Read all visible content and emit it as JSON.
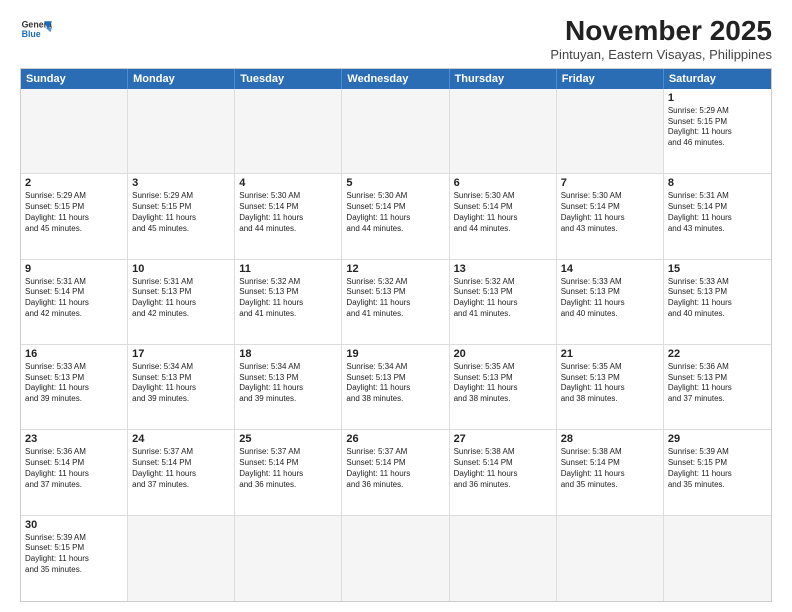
{
  "logo": {
    "line1": "General",
    "line2": "Blue"
  },
  "title": "November 2025",
  "subtitle": "Pintuyan, Eastern Visayas, Philippines",
  "header_days": [
    "Sunday",
    "Monday",
    "Tuesday",
    "Wednesday",
    "Thursday",
    "Friday",
    "Saturday"
  ],
  "weeks": [
    [
      {
        "day": "",
        "text": ""
      },
      {
        "day": "",
        "text": ""
      },
      {
        "day": "",
        "text": ""
      },
      {
        "day": "",
        "text": ""
      },
      {
        "day": "",
        "text": ""
      },
      {
        "day": "",
        "text": ""
      },
      {
        "day": "1",
        "text": "Sunrise: 5:29 AM\nSunset: 5:15 PM\nDaylight: 11 hours\nand 46 minutes."
      }
    ],
    [
      {
        "day": "2",
        "text": "Sunrise: 5:29 AM\nSunset: 5:15 PM\nDaylight: 11 hours\nand 45 minutes."
      },
      {
        "day": "3",
        "text": "Sunrise: 5:29 AM\nSunset: 5:15 PM\nDaylight: 11 hours\nand 45 minutes."
      },
      {
        "day": "4",
        "text": "Sunrise: 5:30 AM\nSunset: 5:14 PM\nDaylight: 11 hours\nand 44 minutes."
      },
      {
        "day": "5",
        "text": "Sunrise: 5:30 AM\nSunset: 5:14 PM\nDaylight: 11 hours\nand 44 minutes."
      },
      {
        "day": "6",
        "text": "Sunrise: 5:30 AM\nSunset: 5:14 PM\nDaylight: 11 hours\nand 44 minutes."
      },
      {
        "day": "7",
        "text": "Sunrise: 5:30 AM\nSunset: 5:14 PM\nDaylight: 11 hours\nand 43 minutes."
      },
      {
        "day": "8",
        "text": "Sunrise: 5:31 AM\nSunset: 5:14 PM\nDaylight: 11 hours\nand 43 minutes."
      }
    ],
    [
      {
        "day": "9",
        "text": "Sunrise: 5:31 AM\nSunset: 5:14 PM\nDaylight: 11 hours\nand 42 minutes."
      },
      {
        "day": "10",
        "text": "Sunrise: 5:31 AM\nSunset: 5:13 PM\nDaylight: 11 hours\nand 42 minutes."
      },
      {
        "day": "11",
        "text": "Sunrise: 5:32 AM\nSunset: 5:13 PM\nDaylight: 11 hours\nand 41 minutes."
      },
      {
        "day": "12",
        "text": "Sunrise: 5:32 AM\nSunset: 5:13 PM\nDaylight: 11 hours\nand 41 minutes."
      },
      {
        "day": "13",
        "text": "Sunrise: 5:32 AM\nSunset: 5:13 PM\nDaylight: 11 hours\nand 41 minutes."
      },
      {
        "day": "14",
        "text": "Sunrise: 5:33 AM\nSunset: 5:13 PM\nDaylight: 11 hours\nand 40 minutes."
      },
      {
        "day": "15",
        "text": "Sunrise: 5:33 AM\nSunset: 5:13 PM\nDaylight: 11 hours\nand 40 minutes."
      }
    ],
    [
      {
        "day": "16",
        "text": "Sunrise: 5:33 AM\nSunset: 5:13 PM\nDaylight: 11 hours\nand 39 minutes."
      },
      {
        "day": "17",
        "text": "Sunrise: 5:34 AM\nSunset: 5:13 PM\nDaylight: 11 hours\nand 39 minutes."
      },
      {
        "day": "18",
        "text": "Sunrise: 5:34 AM\nSunset: 5:13 PM\nDaylight: 11 hours\nand 39 minutes."
      },
      {
        "day": "19",
        "text": "Sunrise: 5:34 AM\nSunset: 5:13 PM\nDaylight: 11 hours\nand 38 minutes."
      },
      {
        "day": "20",
        "text": "Sunrise: 5:35 AM\nSunset: 5:13 PM\nDaylight: 11 hours\nand 38 minutes."
      },
      {
        "day": "21",
        "text": "Sunrise: 5:35 AM\nSunset: 5:13 PM\nDaylight: 11 hours\nand 38 minutes."
      },
      {
        "day": "22",
        "text": "Sunrise: 5:36 AM\nSunset: 5:13 PM\nDaylight: 11 hours\nand 37 minutes."
      }
    ],
    [
      {
        "day": "23",
        "text": "Sunrise: 5:36 AM\nSunset: 5:14 PM\nDaylight: 11 hours\nand 37 minutes."
      },
      {
        "day": "24",
        "text": "Sunrise: 5:37 AM\nSunset: 5:14 PM\nDaylight: 11 hours\nand 37 minutes."
      },
      {
        "day": "25",
        "text": "Sunrise: 5:37 AM\nSunset: 5:14 PM\nDaylight: 11 hours\nand 36 minutes."
      },
      {
        "day": "26",
        "text": "Sunrise: 5:37 AM\nSunset: 5:14 PM\nDaylight: 11 hours\nand 36 minutes."
      },
      {
        "day": "27",
        "text": "Sunrise: 5:38 AM\nSunset: 5:14 PM\nDaylight: 11 hours\nand 36 minutes."
      },
      {
        "day": "28",
        "text": "Sunrise: 5:38 AM\nSunset: 5:14 PM\nDaylight: 11 hours\nand 35 minutes."
      },
      {
        "day": "29",
        "text": "Sunrise: 5:39 AM\nSunset: 5:15 PM\nDaylight: 11 hours\nand 35 minutes."
      }
    ],
    [
      {
        "day": "30",
        "text": "Sunrise: 5:39 AM\nSunset: 5:15 PM\nDaylight: 11 hours\nand 35 minutes."
      },
      {
        "day": "",
        "text": ""
      },
      {
        "day": "",
        "text": ""
      },
      {
        "day": "",
        "text": ""
      },
      {
        "day": "",
        "text": ""
      },
      {
        "day": "",
        "text": ""
      },
      {
        "day": "",
        "text": ""
      }
    ]
  ]
}
